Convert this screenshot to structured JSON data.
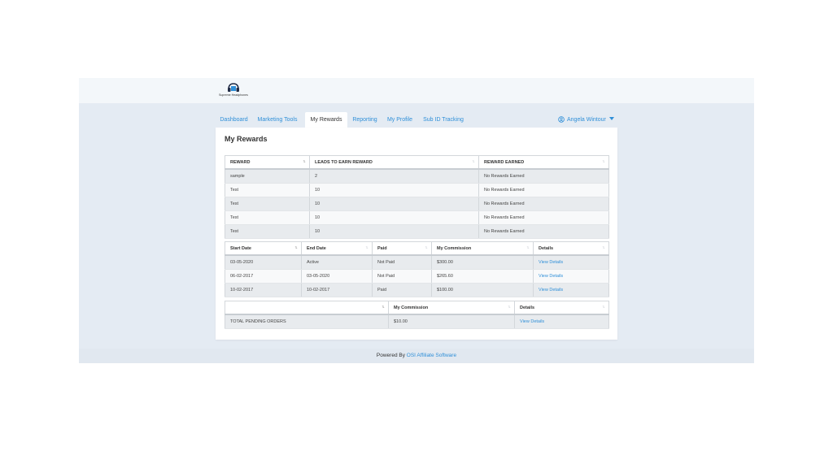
{
  "brand": {
    "logo_text": "Supreme Headphones"
  },
  "nav": [
    {
      "label": "Dashboard"
    },
    {
      "label": "Marketing Tools"
    },
    {
      "label": "My Rewards",
      "active": true
    },
    {
      "label": "Reporting"
    },
    {
      "label": "My Profile"
    },
    {
      "label": "Sub ID Tracking"
    }
  ],
  "user": {
    "name": "Angela Wintour",
    "icon": "user-circle-icon",
    "menu_icon": "caret-down-icon"
  },
  "page": {
    "title": "My Rewards"
  },
  "rewards_table": {
    "headers": [
      "REWARD",
      "LEADS TO EARN REWARD",
      "REWARD EARNED"
    ],
    "rows": [
      [
        "sample",
        "2",
        "No Rewards Earned"
      ],
      [
        "Test",
        "10",
        "No Rewards Earned"
      ],
      [
        "Test",
        "10",
        "No Rewards Earned"
      ],
      [
        "Test",
        "10",
        "No Rewards Earned"
      ],
      [
        "Test",
        "10",
        "No Rewards Earned"
      ]
    ]
  },
  "commission_table": {
    "headers": [
      "Start Date",
      "End Date",
      "Paid",
      "My Commission",
      "Details"
    ],
    "rows": [
      [
        "03-05-2020",
        "Active",
        "Not Paid",
        "$300.00",
        "View Details"
      ],
      [
        "06-02-2017",
        "03-05-2020",
        "Not Paid",
        "$265.60",
        "View Details"
      ],
      [
        "10-02-2017",
        "10-02-2017",
        "Paid",
        "$100.00",
        "View Details"
      ]
    ]
  },
  "pending_table": {
    "headers": [
      "",
      "My Commission",
      "Details"
    ],
    "rows": [
      [
        "TOTAL PENDING ORDERS",
        "$10.00",
        "View Details"
      ]
    ]
  },
  "footer": {
    "prefix": "Powered By",
    "link": "OSI Affiliate Software"
  },
  "colors": {
    "accent": "#2f8fd8",
    "page_bg": "#e4ebf3",
    "row_stripe": "#e8ebee"
  }
}
